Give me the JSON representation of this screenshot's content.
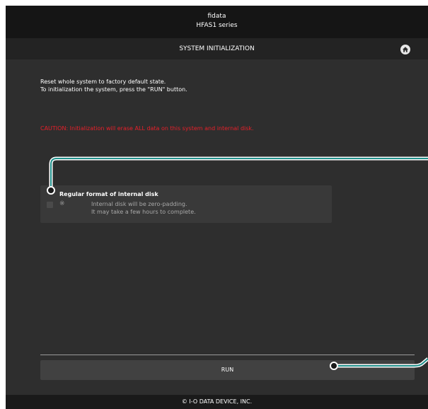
{
  "header": {
    "brand": "fidata",
    "model": "HFAS1 series"
  },
  "titlebar": {
    "title": "SYSTEM INITIALIZATION",
    "home_icon": "home-icon"
  },
  "description": {
    "line1": "Reset whole system to factory default state.",
    "line2": "To initialization the system, press the \"RUN\" button."
  },
  "caution": "CAUTION:  Initialization will erase ALL data on this system and internal disk.",
  "option": {
    "title": "Regular format of internal disk",
    "bullet": "※",
    "note1": "Internal disk will be zero-padding.",
    "note2": "It may take a few hours to complete.",
    "checked": false
  },
  "run_button": {
    "label": "RUN"
  },
  "footer": {
    "copyright": "© I-O DATA DEVICE, INC."
  },
  "colors": {
    "background": "#2e2e2e",
    "header": "#151515",
    "caution": "#e8202a",
    "callout": "#1f8f8a"
  }
}
